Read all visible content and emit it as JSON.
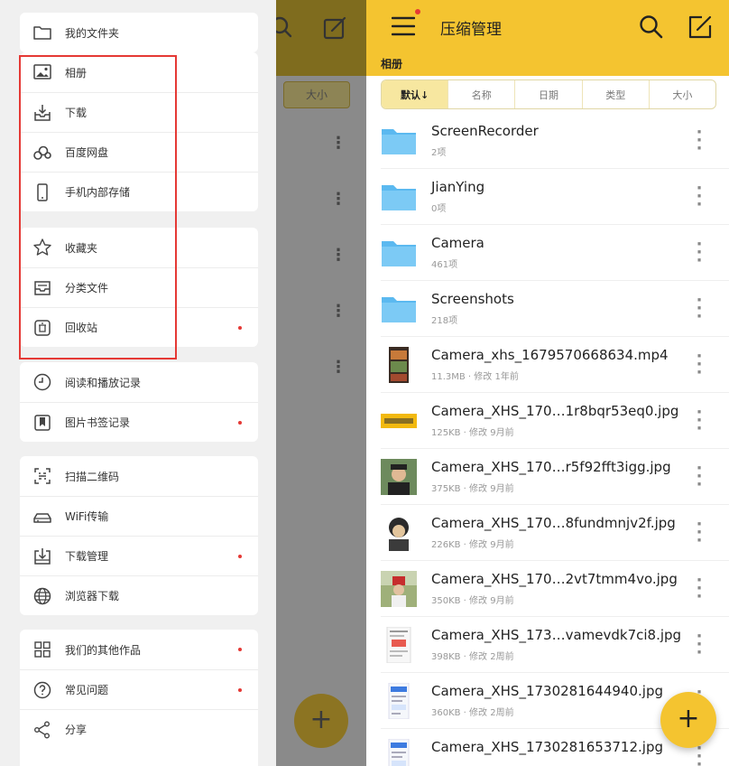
{
  "drawer": {
    "groups": [
      {
        "items": [
          {
            "label": "我的文件夹",
            "icon": "folder-icon",
            "dot": false
          }
        ]
      },
      {
        "items": [
          {
            "label": "相册",
            "icon": "image-icon",
            "dot": false
          },
          {
            "label": "下载",
            "icon": "download-tray-icon",
            "dot": false
          },
          {
            "label": "百度网盘",
            "icon": "cloud-disk-icon",
            "dot": false
          },
          {
            "label": "手机内部存储",
            "icon": "phone-icon",
            "dot": false
          }
        ]
      },
      {
        "items": [
          {
            "label": "收藏夹",
            "icon": "star-icon",
            "dot": false
          },
          {
            "label": "分类文件",
            "icon": "inbox-icon",
            "dot": false
          },
          {
            "label": "回收站",
            "icon": "trash-icon",
            "dot": true
          }
        ]
      },
      {
        "items": [
          {
            "label": "阅读和播放记录",
            "icon": "clock-icon",
            "dot": false
          },
          {
            "label": "图片书签记录",
            "icon": "bookmark-icon",
            "dot": true
          }
        ]
      },
      {
        "items": [
          {
            "label": "扫描二维码",
            "icon": "scan-icon",
            "dot": false
          },
          {
            "label": "WiFi传输",
            "icon": "wifi-transfer-icon",
            "dot": false
          },
          {
            "label": "下载管理",
            "icon": "download-manager-icon",
            "dot": true
          },
          {
            "label": "浏览器下载",
            "icon": "globe-icon",
            "dot": false
          }
        ]
      },
      {
        "items": [
          {
            "label": "我们的其他作品",
            "icon": "grid-icon",
            "dot": true
          },
          {
            "label": "常见问题",
            "icon": "help-icon",
            "dot": true
          },
          {
            "label": "分享",
            "icon": "share-icon",
            "dot": false
          }
        ]
      }
    ]
  },
  "background": {
    "sort_label": "大小",
    "fab_label": "+"
  },
  "header": {
    "title": "压缩管理",
    "subtitle": "相册"
  },
  "sort_options": [
    "默认↓",
    "名称",
    "日期",
    "类型",
    "大小"
  ],
  "files": [
    {
      "name": "ScreenRecorder",
      "meta": "2项",
      "type": "folder"
    },
    {
      "name": "JianYing",
      "meta": "0项",
      "type": "folder"
    },
    {
      "name": "Camera",
      "meta": "461项",
      "type": "folder"
    },
    {
      "name": "Screenshots",
      "meta": "218项",
      "type": "folder"
    },
    {
      "name": "Camera_xhs_1679570668634.mp4",
      "meta": "11.3MB · 修改 1年前",
      "type": "video"
    },
    {
      "name": "Camera_XHS_170…1r8bqr53eq0.jpg",
      "meta": "125KB · 修改 9月前",
      "type": "image-yellow"
    },
    {
      "name": "Camera_XHS_170…r5f92fft3igg.jpg",
      "meta": "375KB · 修改 9月前",
      "type": "image-person"
    },
    {
      "name": "Camera_XHS_170…8fundmnjv2f.jpg",
      "meta": "226KB · 修改 9月前",
      "type": "image-cartoon"
    },
    {
      "name": "Camera_XHS_170…2vt7tmm4vo.jpg",
      "meta": "350KB · 修改 9月前",
      "type": "image-outdoor"
    },
    {
      "name": "Camera_XHS_173…vamevdk7ci8.jpg",
      "meta": "398KB · 修改 2周前",
      "type": "image-document"
    },
    {
      "name": "Camera_XHS_1730281644940.jpg",
      "meta": "360KB · 修改 2周前",
      "type": "image-screenshot"
    },
    {
      "name": "Camera_XHS_1730281653712.jpg",
      "meta": "",
      "type": "image-screenshot"
    }
  ],
  "fab_label": "+",
  "colors": {
    "accent": "#f4c430",
    "folder": "#5bb9f0",
    "badge": "#e53935"
  }
}
